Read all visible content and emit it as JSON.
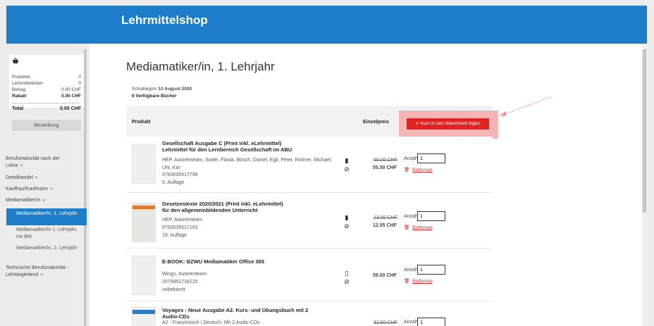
{
  "header": {
    "brand": "Lehrmittelshop"
  },
  "cart": {
    "rows": [
      {
        "label": "Produkte",
        "value": "0"
      },
      {
        "label": "Lehrmittellisten",
        "value": "0"
      },
      {
        "label": "Betrag",
        "value": "0.00 CHF"
      },
      {
        "label": "Rabatt",
        "value": "0.00 CHF"
      }
    ],
    "total_label": "Total",
    "total_value": "0.00 CHF",
    "order_button": "Bestellung"
  },
  "nav": {
    "items": [
      {
        "label": "Berufsmaturität nach der",
        "label2": "Lehre",
        "chev": ">"
      },
      {
        "label": "Detailhandel",
        "chev": ">"
      },
      {
        "label": "Kauffrau/Kaufmann",
        "chev": ">"
      },
      {
        "label": "Mediamatiker/in",
        "chev": "v"
      }
    ],
    "active": "Mediamatiker/in, 1. Lehrjahr",
    "subitems": [
      "Mediamatiker/in 1. Lehrjahr, mit BM",
      "Mediamatiker/in, 2. Lehrjahr"
    ],
    "last_item": "Technische Berufsmaturität - Lehrbegleitend",
    "last_chev": ">"
  },
  "main": {
    "title": "Mediamatiker/in, 1. Lehrjahr",
    "school_start_label": "Schulbeginn",
    "school_start_date": "10 August 2020",
    "available_books": "6 Verfügbare Bücher",
    "col_product": "Produkt",
    "col_price": "Einzelpreis",
    "add_all_button": "Kurs in den Warenkorb legen",
    "qty_label": "Anzahl",
    "remove_label": "Entfernen"
  },
  "products": [
    {
      "title1": "Gesellschaft Ausgabe C (Print inkl. eLehrmittel)",
      "title2": "Lehrmittel für den Lernbereich Gesellschaft im ABU",
      "authors": "HEP, Autorenteam, Sutter, Flavia, Bösch, Daniel, Egli, Peter, Rohner, Michael, Uhr, Kar",
      "isbn": "9783035517798",
      "edition": "5. Auflage",
      "old_price": "60.00 CHF",
      "price": "55.50 CHF",
      "qty": "1"
    },
    {
      "title1": "Gesetzestexte 2020/2021 (Print inkl. eLehrmittel)",
      "title2": "für den allgemeinbildenden Unterricht",
      "authors": "HEP, Autorenteam",
      "isbn": "9783035517163",
      "edition": "19. Auflage",
      "old_price": "13.00 CHF",
      "price": "12.05 CHF",
      "qty": "1"
    },
    {
      "title1": "E-BOOK: BZWU Mediamatiker Office 365",
      "authors": "Wings, Autorenteam",
      "isbn": "2079951734225",
      "edition": "unbekannt",
      "price": "59.00 CHF",
      "qty": "1"
    },
    {
      "title1": "Voyages - Neue Ausgabe A2. Kurs- und Übungsbuch mit 2",
      "title2": "Audio-CDs",
      "authors": "A2 - Französisch / Deutsch. Mit 2 Audio-CDs",
      "old_price": "32.50 CHF",
      "qty": "1"
    }
  ],
  "colors": {
    "brand_blue": "#1e7dc8",
    "accent_red": "#e02424",
    "highlight": "#f5b5b5"
  }
}
